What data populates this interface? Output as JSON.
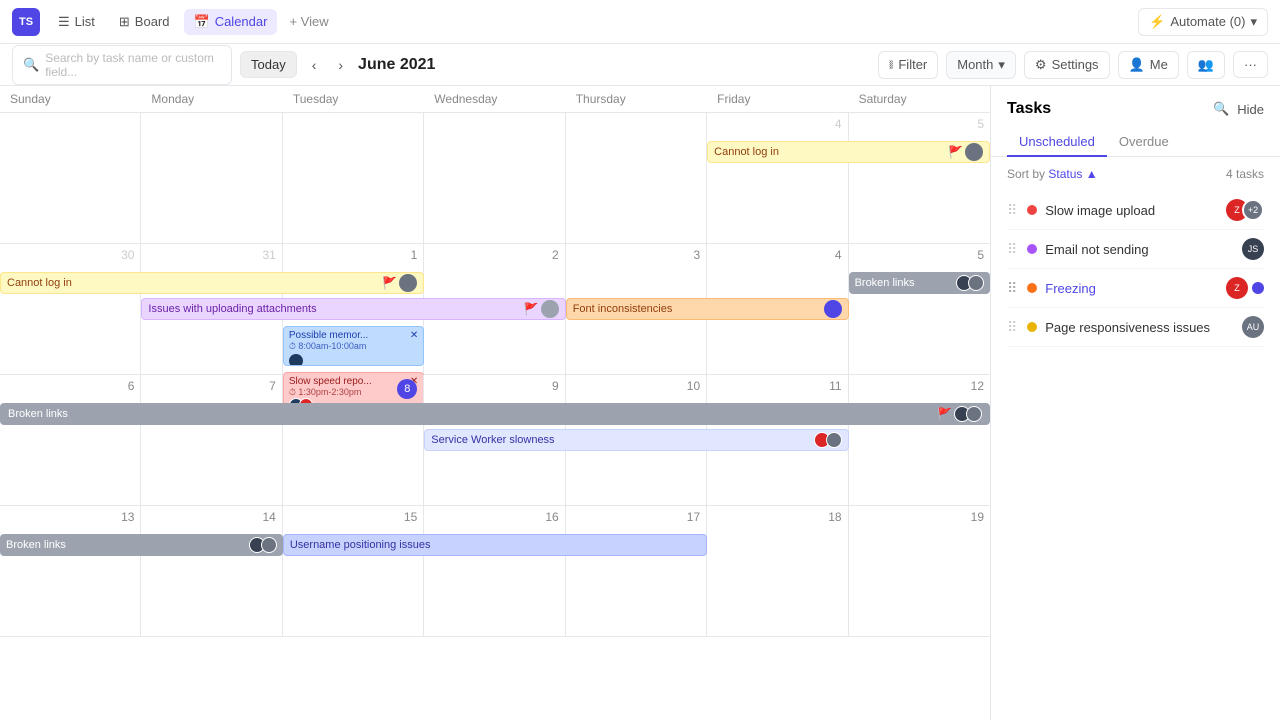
{
  "app": {
    "icon": "TS",
    "title": "TS"
  },
  "nav": {
    "tabs": [
      {
        "id": "list",
        "label": "List",
        "icon": "☰",
        "active": false
      },
      {
        "id": "board",
        "label": "Board",
        "icon": "▦",
        "active": false
      },
      {
        "id": "calendar",
        "label": "Calendar",
        "icon": "📅",
        "active": true
      }
    ],
    "add_view": "+ View",
    "automate": "Automate (0)"
  },
  "toolbar": {
    "search_placeholder": "Search by task name or custom field...",
    "today": "Today",
    "month_title": "June 2021",
    "filter": "Filter",
    "month": "Month",
    "settings": "Settings",
    "me": "Me",
    "more": "···"
  },
  "calendar": {
    "day_headers": [
      "Sunday",
      "Monday",
      "Tuesday",
      "Wednesday",
      "Thursday",
      "Friday",
      "Saturday"
    ],
    "weeks": [
      {
        "days": [
          {
            "num": "",
            "gray": true
          },
          {
            "num": "",
            "gray": true
          },
          {
            "num": "",
            "gray": true
          },
          {
            "num": "",
            "gray": true
          },
          {
            "num": "",
            "gray": true
          },
          {
            "num": "4",
            "gray": true
          },
          {
            "num": "5",
            "gray": true
          }
        ],
        "events": [
          {
            "id": "cannot-log-fri",
            "label": "Cannot log in",
            "color_bg": "#fef9c3",
            "color_text": "#92400e"
          }
        ]
      },
      {
        "days": [
          {
            "num": "30",
            "gray": true
          },
          {
            "num": "31",
            "gray": true
          },
          {
            "num": "1",
            "today": false
          },
          {
            "num": "2"
          },
          {
            "num": "3"
          },
          {
            "num": "4"
          },
          {
            "num": "5"
          }
        ],
        "events": [
          {
            "id": "cannot-log-week2",
            "label": "Cannot log in",
            "bg": "#fef9c3",
            "color": "#92400e"
          },
          {
            "id": "issues-upload",
            "label": "Issues with uploading attachments",
            "bg": "#e9d5ff",
            "color": "#6b21a8"
          },
          {
            "id": "possible-mem",
            "label": "Possible memory leak",
            "bg": "#bfdbfe",
            "color": "#1e40af",
            "time": "8:00am-10:00am"
          },
          {
            "id": "slow-speed",
            "label": "Slow speed repo...",
            "bg": "#fecaca",
            "color": "#991b1b",
            "time": "1:30pm-2:30pm"
          },
          {
            "id": "font-incon",
            "label": "Font inconsistencies",
            "bg": "#fed7aa",
            "color": "#92400e"
          },
          {
            "id": "broken-links-sat",
            "label": "Broken links",
            "bg": "#9ca3af",
            "color": "#fff"
          }
        ]
      },
      {
        "days": [
          {
            "num": "6"
          },
          {
            "num": "7"
          },
          {
            "num": "8",
            "today": true
          },
          {
            "num": "9"
          },
          {
            "num": "10"
          },
          {
            "num": "11"
          },
          {
            "num": "12"
          }
        ],
        "events": [
          {
            "id": "broken-links-week3",
            "label": "Broken links",
            "bg": "#9ca3af",
            "color": "#fff"
          },
          {
            "id": "service-worker",
            "label": "Service Worker slowness",
            "bg": "#e0e7ff",
            "color": "#3730a3"
          }
        ]
      },
      {
        "days": [
          {
            "num": "13"
          },
          {
            "num": "14"
          },
          {
            "num": "15"
          },
          {
            "num": "16"
          },
          {
            "num": "17"
          },
          {
            "num": "18"
          },
          {
            "num": "19"
          }
        ],
        "events": [
          {
            "id": "broken-links-week4",
            "label": "Broken links",
            "bg": "#9ca3af",
            "color": "#fff"
          },
          {
            "id": "username-pos",
            "label": "Username positioning issues",
            "bg": "#c7d2fe",
            "color": "#3730a3"
          }
        ]
      }
    ]
  },
  "tasks_panel": {
    "title": "Tasks",
    "tabs": [
      {
        "label": "Unscheduled",
        "active": true
      },
      {
        "label": "Overdue",
        "active": false
      }
    ],
    "sort_label": "Sort by",
    "sort_field": "Status",
    "task_count": "4 tasks",
    "tasks": [
      {
        "id": 1,
        "name": "Slow image upload",
        "dot_color": "#ef4444",
        "avatar_color": "#dc2626"
      },
      {
        "id": 2,
        "name": "Email not sending",
        "dot_color": "#a855f7",
        "avatar_color": "#7c3aed"
      },
      {
        "id": 3,
        "name": "Freezing",
        "dot_color": "#f97316",
        "blue": true,
        "avatar_color": "#dc2626"
      },
      {
        "id": 4,
        "name": "Page responsiveness issues",
        "dot_color": "#eab308",
        "avatar_color": "#6b7280"
      }
    ]
  }
}
